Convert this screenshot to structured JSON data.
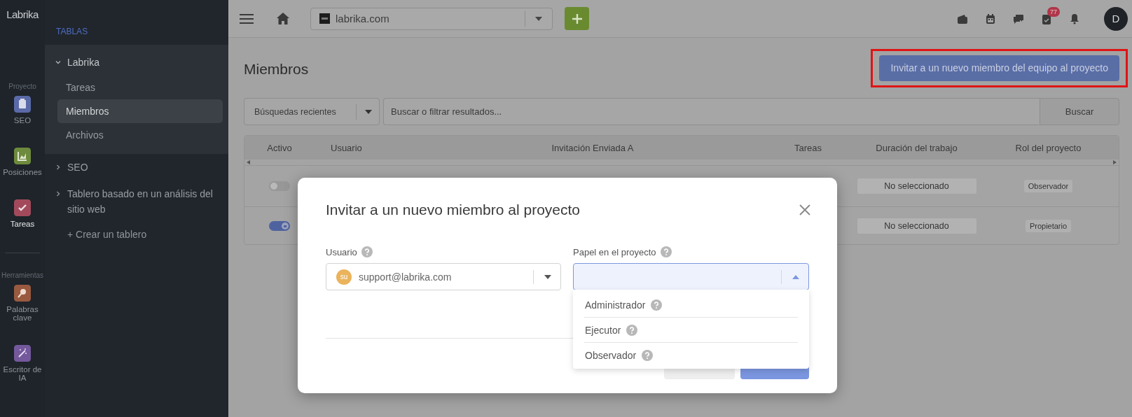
{
  "rail": {
    "logo": "Labrika",
    "sections": [
      {
        "title": "Proyecto",
        "items": [
          {
            "label": "SEO",
            "color": "#5a6aa8",
            "selected": false
          },
          {
            "label": "Posiciones",
            "color": "#6e8a3c",
            "selected": false
          },
          {
            "label": "Tareas",
            "color": "#a24a5c",
            "selected": true
          }
        ]
      },
      {
        "title": "Herramientas",
        "items": [
          {
            "label": "Palabras clave",
            "color": "#9a5a40",
            "selected": false
          },
          {
            "label": "Escritor de IA",
            "color": "#74589c",
            "selected": false
          }
        ]
      }
    ]
  },
  "sidebar": {
    "heading": "TABLAS",
    "items": [
      {
        "label": "Labrika",
        "expanded": true,
        "children": [
          {
            "label": "Tareas",
            "selected": false
          },
          {
            "label": "Miembros",
            "selected": true
          },
          {
            "label": "Archivos",
            "selected": false
          }
        ]
      },
      {
        "label": "SEO",
        "expanded": false
      },
      {
        "label": "Tablero basado en un análisis del sitio web",
        "expanded": false
      }
    ],
    "create": "+ Crear un tablero"
  },
  "topbar": {
    "site": "labrika.com",
    "notifications": "77",
    "avatar": "D"
  },
  "page": {
    "title": "Miembros",
    "invite_button": "Invitar a un nuevo miembro del equipo al proyecto",
    "search": {
      "recent": "Búsquedas recientes",
      "placeholder": "Buscar o filtrar resultados...",
      "button": "Buscar"
    },
    "table": {
      "columns": [
        "Activo",
        "Usuario",
        "Invitación Enviada A",
        "Tareas",
        "Duración del trabajo",
        "Rol del proyecto"
      ],
      "rows": [
        {
          "active": false,
          "duration": "No seleccionado",
          "role": "Observador"
        },
        {
          "active": true,
          "duration": "No seleccionado",
          "role": "Propietario"
        }
      ]
    }
  },
  "modal": {
    "title": "Invitar a un nuevo miembro al proyecto",
    "user": {
      "label": "Usuario",
      "avatar": "su",
      "value": "support@labrika.com"
    },
    "role": {
      "label": "Papel en el proyecto",
      "open": true,
      "options": [
        "Administrador",
        "Ejecutor",
        "Observador"
      ]
    }
  }
}
